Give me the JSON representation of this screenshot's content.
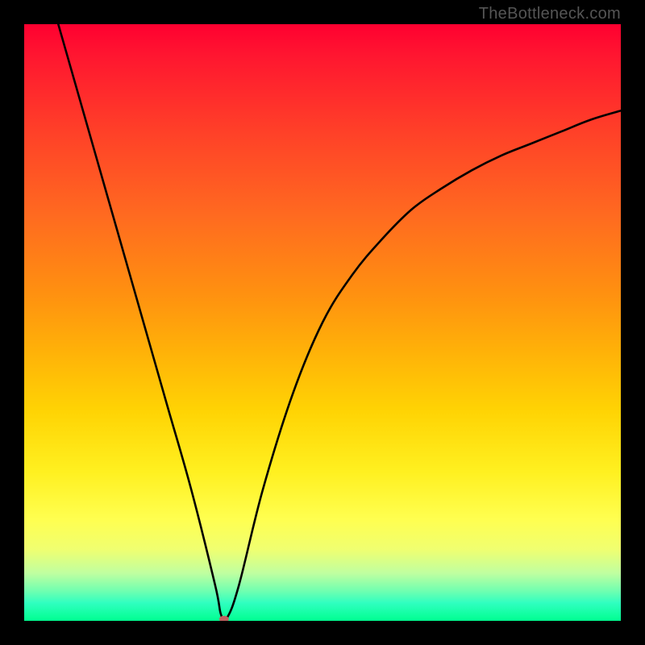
{
  "watermark": "TheBottleneck.com",
  "chart_data": {
    "type": "line",
    "title": "",
    "xlabel": "",
    "ylabel": "",
    "xlim": [
      0,
      100
    ],
    "ylim": [
      0,
      100
    ],
    "grid": false,
    "series": [
      {
        "name": "bottleneck-curve",
        "x": [
          4,
          8,
          12,
          16,
          20,
          24,
          28,
          32,
          33,
          34,
          36,
          40,
          45,
          50,
          55,
          60,
          65,
          70,
          75,
          80,
          85,
          90,
          95,
          100
        ],
        "values": [
          106,
          92,
          78,
          64,
          50,
          36,
          22,
          6,
          1,
          0.5,
          6,
          22,
          38,
          50,
          58,
          64,
          69,
          72.5,
          75.5,
          78,
          80,
          82,
          84,
          85.5
        ],
        "color": "#000000"
      }
    ],
    "marker": {
      "x": 33.5,
      "y": 0.3,
      "color": "#c06060"
    }
  }
}
